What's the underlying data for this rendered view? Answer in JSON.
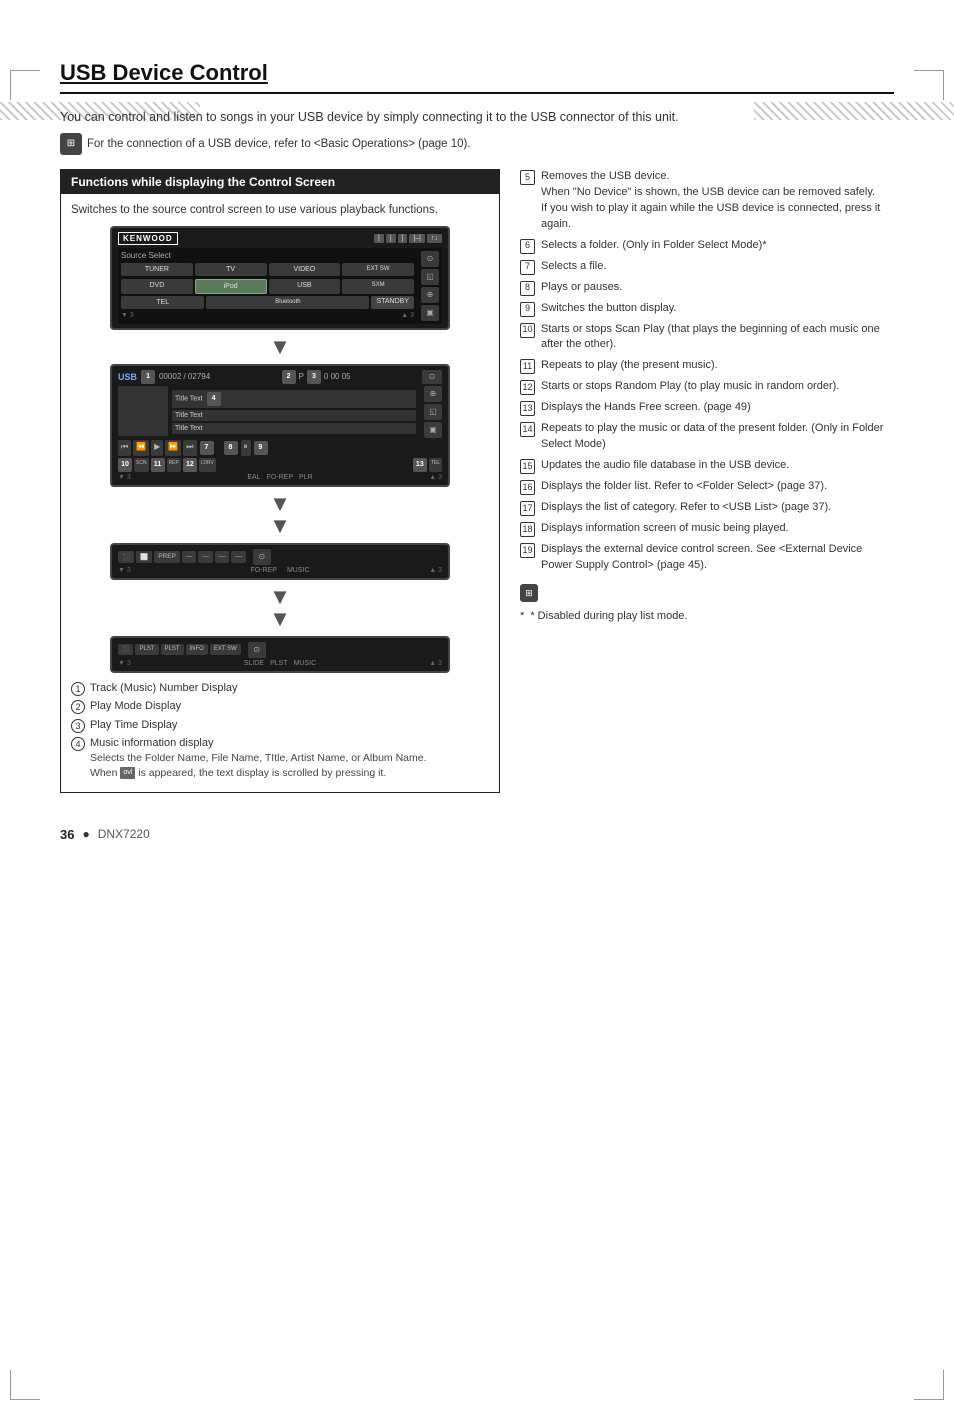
{
  "page": {
    "title": "USB Device Control",
    "intro": "You can control and listen to songs in your USB device by simply connecting it to the USB connector of this unit.",
    "note": "For the connection of a USB device, refer to <Basic Operations> (page 10).",
    "page_number": "36",
    "model": "DNX7220"
  },
  "functions_box": {
    "header": "Functions while displaying the Control Screen",
    "description": "Switches to the source control screen to use various playback functions."
  },
  "screens": {
    "source_select": {
      "logo": "KENWOOD",
      "label": "Source Select",
      "buttons_row1": [
        "TUNER",
        "TV",
        "VIDEO"
      ],
      "buttons_row2": [
        "DVD",
        "iPod",
        "USB"
      ],
      "extras": [
        "EXT SW",
        "SXM",
        "TEL",
        "Bluetooth"
      ],
      "standby": "STANDBY"
    },
    "usb_play": {
      "label": "USB",
      "track_num": "00002 / 02794",
      "play_indicator": "P",
      "time": "0 00 05",
      "text_lines": [
        "Title Text",
        "Title Text",
        "Title Text"
      ],
      "controls": [
        "SCN",
        "REP",
        "i.DRV",
        "TEL"
      ],
      "bottom_labels": [
        "EAL",
        "FO-REP",
        "PLR"
      ]
    },
    "screen3": {
      "controls": [
        "PREP",
        "MUSIC"
      ],
      "bottom": "FO-REP MUSIC"
    },
    "screen4": {
      "controls": [
        "SLIDE",
        "PLST",
        "MUSIC"
      ],
      "buttons": [
        "PLST",
        "PLST",
        "INFO",
        "EXT SW"
      ]
    }
  },
  "label_items": [
    {
      "num": "1",
      "text": "Track (Music) Number Display"
    },
    {
      "num": "2",
      "text": "Play Mode Display"
    },
    {
      "num": "3",
      "text": "Play Time Display"
    },
    {
      "num": "4",
      "text": "Music information display",
      "sub": "Selects the Folder Name, File Name, TItle, Artist Name, or Album Name. When the text display is scrolled by pressing it."
    }
  ],
  "right_items": [
    {
      "num": "5",
      "text": "Removes the USB device. When \"No Device\" is shown, the USB device can be removed safely. If you wish to play it again while the USB device is connected, press it again."
    },
    {
      "num": "6",
      "text": "Selects a folder. (Only in Folder Select Mode)*"
    },
    {
      "num": "7",
      "text": "Selects a file."
    },
    {
      "num": "8",
      "text": "Plays or pauses."
    },
    {
      "num": "9",
      "text": "Switches the button display."
    },
    {
      "num": "10",
      "text": "Starts or stops Scan Play (that plays the beginning of each music one after the other)."
    },
    {
      "num": "11",
      "text": "Repeats to play (the present music)."
    },
    {
      "num": "12",
      "text": "Starts or stops Random Play (to play music in random order)."
    },
    {
      "num": "13",
      "text": "Displays the Hands Free screen. (page 49)"
    },
    {
      "num": "14",
      "text": "Repeats to play the music or data of the present folder. (Only in Folder Select Mode)"
    },
    {
      "num": "15",
      "text": "Updates the audio file database in the USB device."
    },
    {
      "num": "16",
      "text": "Displays the folder list. Refer to <Folder Select> (page 37)."
    },
    {
      "num": "17",
      "text": "Displays the list of category. Refer to <USB List> (page 37)."
    },
    {
      "num": "18",
      "text": "Displays information screen of music being played."
    },
    {
      "num": "19",
      "text": "Displays the external device control screen. See <External Device Power Supply Control> (page 45)."
    }
  ],
  "note_bottom": "* Disabled during play list mode.",
  "icons": {
    "note_icon": "⊞",
    "arrow_down": "▼",
    "arrow_down_double": "▼▼"
  }
}
